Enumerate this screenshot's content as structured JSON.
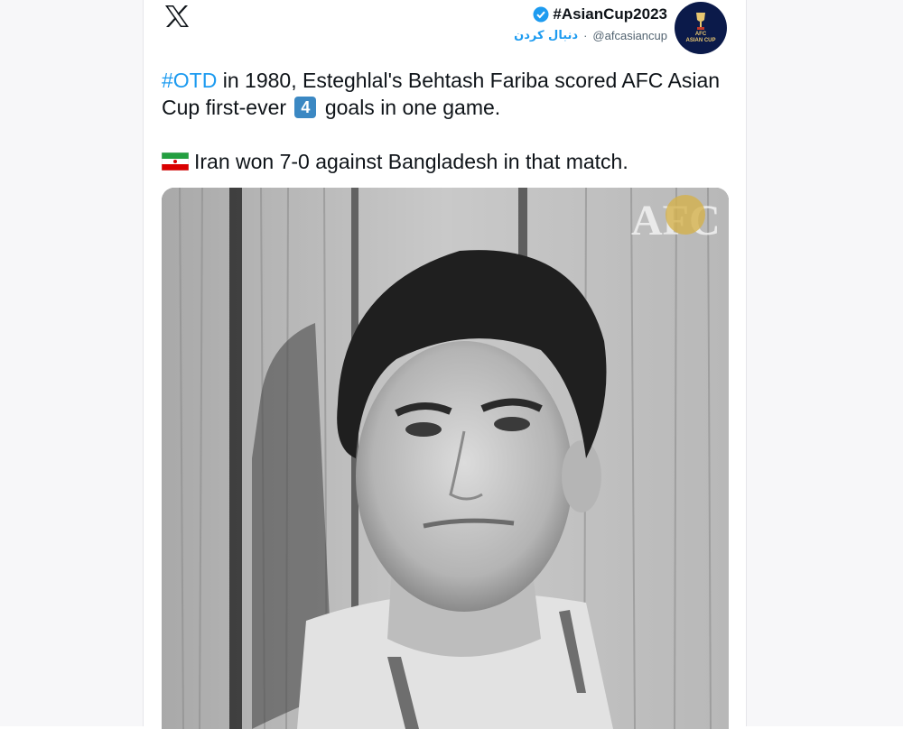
{
  "tweet": {
    "display_name": "#AsianCup2023",
    "handle": "@afcasiancup",
    "follow_label": "دنبال کردن",
    "separator": "·",
    "line1_hashtag": "#OTD",
    "line1_rest": " in 1980, Esteghlal's Behtash Fariba scored AFC Asian Cup first-ever ",
    "goals_count": "4",
    "line1_end": " goals in one game.",
    "line2": "Iran won 7-0 against Bangladesh in that match."
  },
  "avatar": {
    "text_line1": "AFC",
    "text_line2": "ASIAN CUP"
  },
  "media": {
    "watermark": "AFC"
  },
  "icons": {
    "logo": "x-logo-icon",
    "verified": "verified-badge-icon",
    "flag": "iran-flag-icon"
  },
  "colors": {
    "link": "#1d9bf0",
    "keycap": "#3b88c3",
    "text": "#0f1419",
    "muted": "#536471"
  }
}
